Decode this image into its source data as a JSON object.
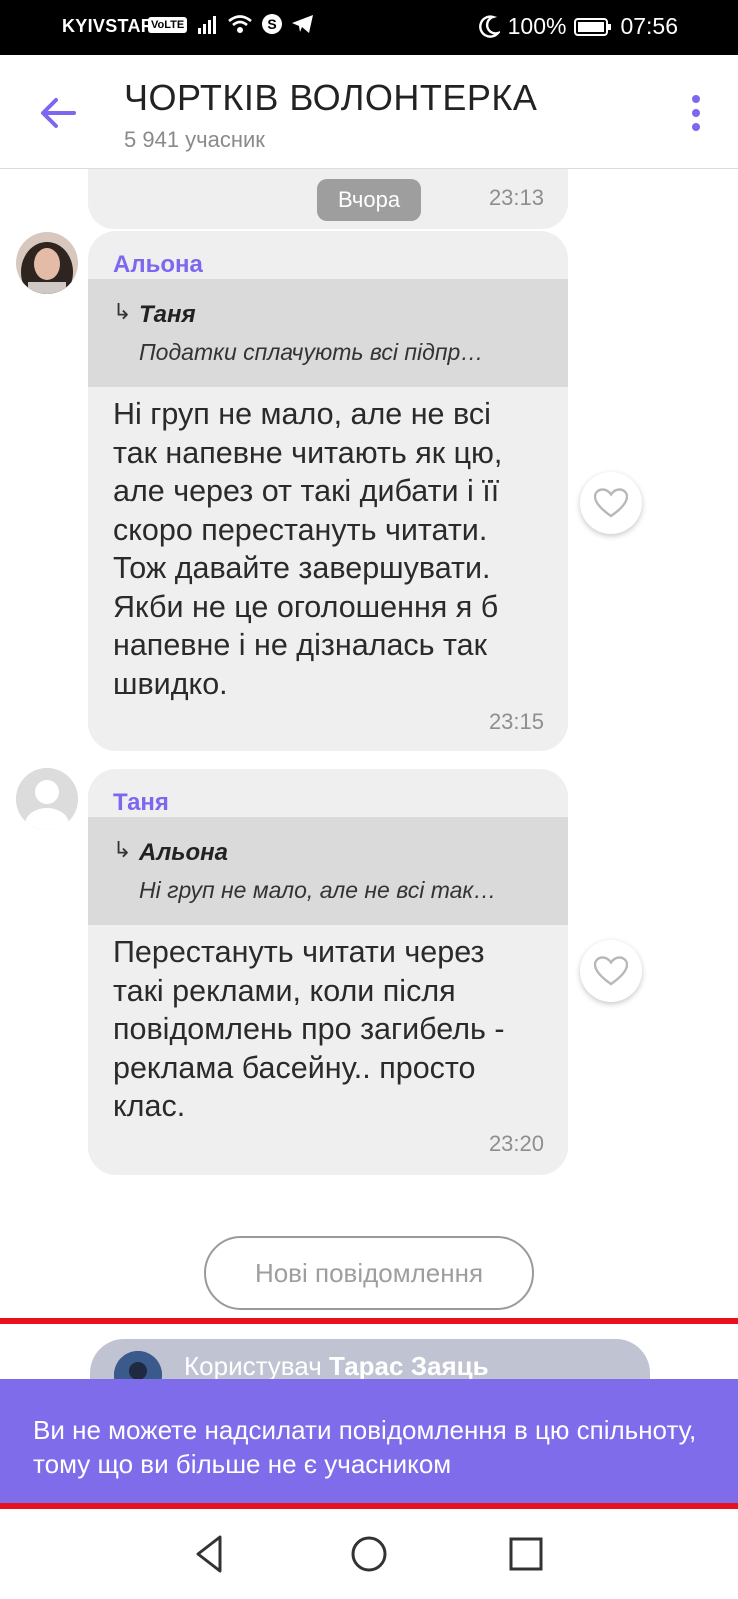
{
  "status_bar": {
    "carrier": "KYIVSTAR",
    "volte": "VoLTE",
    "battery": "100%",
    "time": "07:56"
  },
  "header": {
    "title": "ЧОРТКІВ ВОЛОНТЕРКА",
    "subtitle": "5 941 учасник",
    "accent_color": "#7b68ee"
  },
  "previous_message": {
    "date_label": "Вчора",
    "time": "23:13"
  },
  "messages": [
    {
      "sender": "Альона",
      "reply_arrow": "↳",
      "reply_to_name": "Таня",
      "reply_to_text": "Податки сплачують всі підпр…",
      "text_lines": [
        "Ні груп не мало, але не всі",
        "так напевне читають як цю,",
        "але через от такі дибати і її",
        "скоро перестануть читати.",
        "Тож давайте завершувати.",
        "Якби не це оголошення я б",
        "напевне і не дізналась так",
        "швидко."
      ],
      "time": "23:15"
    },
    {
      "sender": "Таня",
      "reply_arrow": "↳",
      "reply_to_name": "Альона",
      "reply_to_text": "Ні груп не мало, але не всі так…",
      "text_lines": [
        "Перестануть читати через",
        "такі реклами, коли після",
        "повідомлень про загибель -",
        "реклама басейну.. просто",
        "клас."
      ],
      "time": "23:20"
    }
  ],
  "new_messages_label": "Нові повідомлення",
  "system_message": {
    "prefix": "Користувач",
    "name": "Тарас Заяць"
  },
  "banner": {
    "text": "Ви не можете надсилати повідомлення в цю спільноту, тому що ви більше не є учасником",
    "color": "#7e6ceb"
  },
  "highlight_color": "#e8111d",
  "nav_bar": {
    "icons": [
      "back-triangle-icon",
      "home-circle-icon",
      "recents-square-icon"
    ]
  }
}
